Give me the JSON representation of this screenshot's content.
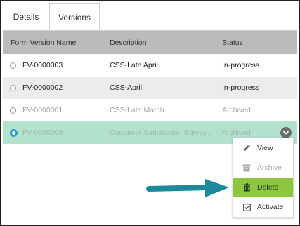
{
  "tabs": [
    {
      "label": "Details",
      "active": false
    },
    {
      "label": "Versions",
      "active": true
    }
  ],
  "table": {
    "headers": {
      "name": "Form Version Name",
      "description": "Description",
      "status": "Status"
    },
    "rows": [
      {
        "name": "FV-0000003",
        "description": "CSS-Late April",
        "status": "In-progress"
      },
      {
        "name": "FV-0000002",
        "description": "CSS-April",
        "status": "In-progress"
      },
      {
        "name": "FV-0000001",
        "description": "CSS-Late March",
        "status": "Archived"
      },
      {
        "name": "FV-0000000",
        "description": "Customer Satisfaction Survey ...",
        "status": "Archived"
      }
    ]
  },
  "context_menu": {
    "items": [
      {
        "label": "View",
        "icon": "pencil-icon",
        "disabled": false
      },
      {
        "label": "Archive",
        "icon": "archive-box-icon",
        "disabled": true
      },
      {
        "label": "Delete",
        "icon": "trash-icon",
        "disabled": false,
        "highlighted": true
      },
      {
        "label": "Activate",
        "icon": "checkbox-icon",
        "disabled": false
      }
    ]
  },
  "colors": {
    "selected_row": "#b3e2cc",
    "highlight": "#8dc63f",
    "arrow": "#1c8a9a",
    "header_bg": "#b9bbbd"
  }
}
